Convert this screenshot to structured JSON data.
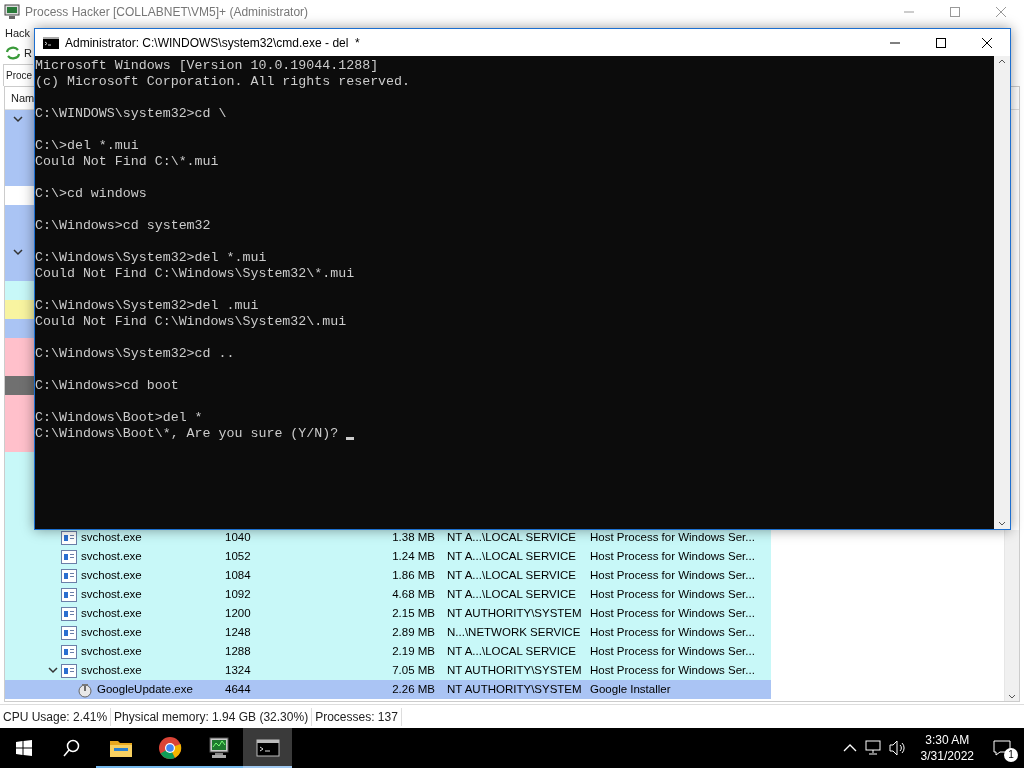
{
  "main_window": {
    "title": "Process Hacker [COLLABNET\\VM5]+ (Administrator)",
    "menu_item": "Hack",
    "toolbar_item": "R",
    "tab": "Proce",
    "column_1": "Nam"
  },
  "covered_rows": [
    {
      "color": "#aac4f4",
      "expanded": true
    },
    {
      "color": "#aac4f4",
      "expanded": false
    },
    {
      "color": "#aac4f4",
      "expanded": false
    },
    {
      "color": "#aac4f4",
      "expanded": false
    },
    {
      "color": "#ffffff",
      "expanded": false
    },
    {
      "color": "#aac4f4",
      "expanded": false
    },
    {
      "color": "#aac4f4",
      "expanded": false
    },
    {
      "color": "#aac4f4",
      "expanded": true
    },
    {
      "color": "#aac4f4",
      "expanded": false
    },
    {
      "color": "#c8f8f8",
      "expanded": false
    },
    {
      "color": "#f8f4a0",
      "expanded": false
    },
    {
      "color": "#aac4f4",
      "expanded": false
    },
    {
      "color": "#ffc0cb",
      "expanded": false
    },
    {
      "color": "#ffc0cb",
      "expanded": false
    },
    {
      "color": "#707070",
      "expanded": false
    },
    {
      "color": "#ffc0cb",
      "expanded": false
    },
    {
      "color": "#ffc0cb",
      "expanded": false
    },
    {
      "color": "#ffc0cb",
      "expanded": false
    },
    {
      "color": "#c8f8f8",
      "expanded": false
    },
    {
      "color": "#c8f8f8",
      "expanded": false
    },
    {
      "color": "#c8f8f8",
      "expanded": false
    },
    {
      "color": "#c8f8f8",
      "expanded": false
    }
  ],
  "rows": [
    {
      "name": "svchost.exe",
      "pid": "1040",
      "private_bytes": "1.38 MB",
      "user": "NT A...\\LOCAL SERVICE",
      "description": "Host Process for Windows Ser...",
      "selected": false,
      "expanded": false
    },
    {
      "name": "svchost.exe",
      "pid": "1052",
      "private_bytes": "1.24 MB",
      "user": "NT A...\\LOCAL SERVICE",
      "description": "Host Process for Windows Ser...",
      "selected": false,
      "expanded": false
    },
    {
      "name": "svchost.exe",
      "pid": "1084",
      "private_bytes": "1.86 MB",
      "user": "NT A...\\LOCAL SERVICE",
      "description": "Host Process for Windows Ser...",
      "selected": false,
      "expanded": false
    },
    {
      "name": "svchost.exe",
      "pid": "1092",
      "private_bytes": "4.68 MB",
      "user": "NT A...\\LOCAL SERVICE",
      "description": "Host Process for Windows Ser...",
      "selected": false,
      "expanded": false
    },
    {
      "name": "svchost.exe",
      "pid": "1200",
      "private_bytes": "2.15 MB",
      "user": "NT AUTHORITY\\SYSTEM",
      "description": "Host Process for Windows Ser...",
      "selected": false,
      "expanded": false
    },
    {
      "name": "svchost.exe",
      "pid": "1248",
      "private_bytes": "2.89 MB",
      "user": "N...\\NETWORK SERVICE",
      "description": "Host Process for Windows Ser...",
      "selected": false,
      "expanded": false
    },
    {
      "name": "svchost.exe",
      "pid": "1288",
      "private_bytes": "2.19 MB",
      "user": "NT A...\\LOCAL SERVICE",
      "description": "Host Process for Windows Ser...",
      "selected": false,
      "expanded": false
    },
    {
      "name": "svchost.exe",
      "pid": "1324",
      "private_bytes": "7.05 MB",
      "user": "NT AUTHORITY\\SYSTEM",
      "description": "Host Process for Windows Ser...",
      "selected": false,
      "expanded": true,
      "children": [
        {
          "name": "GoogleUpdate.exe",
          "pid": "4644",
          "private_bytes": "2.26 MB",
          "user": "NT AUTHORITY\\SYSTEM",
          "description": "Google Installer",
          "selected": true,
          "expanded": false
        }
      ]
    }
  ],
  "status_bar": [
    "CPU Usage: 2.41%",
    "Physical memory: 1.94 GB (32.30%)",
    "Processes: 137"
  ],
  "console": {
    "title": "Administrator: C:\\WINDOWS\\system32\\cmd.exe - del  *",
    "blocks": [
      [
        "Microsoft Windows [Version 10.0.19044.1288]",
        "(c) Microsoft Corporation. All rights reserved."
      ],
      [
        "C:\\WINDOWS\\system32>cd \\"
      ],
      [
        "C:\\>del *.mui",
        "Could Not Find C:\\*.mui"
      ],
      [
        "C:\\>cd windows"
      ],
      [
        "C:\\Windows>cd system32"
      ],
      [
        "C:\\Windows\\System32>del *.mui",
        "Could Not Find C:\\Windows\\System32\\*.mui"
      ],
      [
        "C:\\Windows\\System32>del .mui",
        "Could Not Find C:\\Windows\\System32\\.mui"
      ],
      [
        "C:\\Windows\\System32>cd .."
      ],
      [
        "C:\\Windows>cd boot"
      ],
      [
        "C:\\Windows\\Boot>del *",
        "C:\\Windows\\Boot\\*, Are you sure (Y/N)? "
      ]
    ]
  },
  "taskbar": {
    "apps": [
      {
        "running": true,
        "selected": false
      },
      {
        "running": true,
        "selected": false
      },
      {
        "running": true,
        "selected": false
      },
      {
        "running": true,
        "selected": true
      }
    ],
    "time": "3:30 AM",
    "date": "3/31/2022",
    "notification_count": "1"
  }
}
